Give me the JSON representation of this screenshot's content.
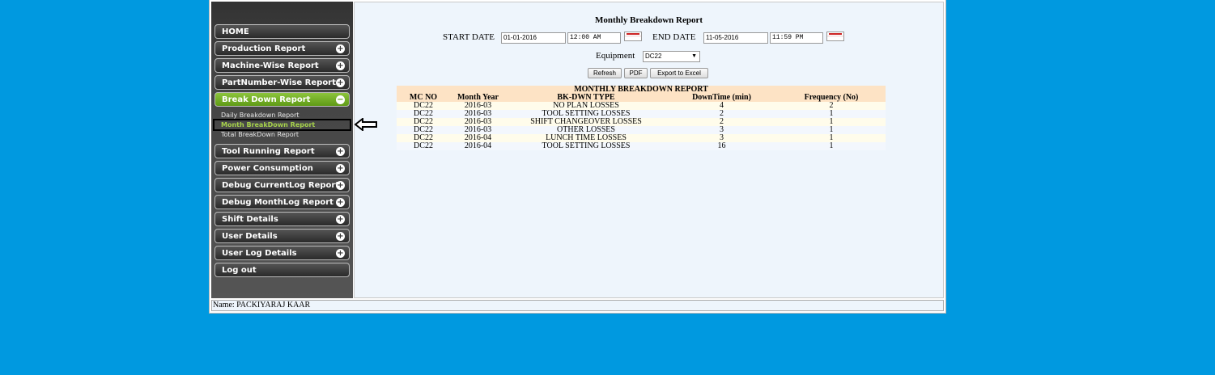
{
  "sidebar": {
    "items": [
      {
        "label": "HOME",
        "plus": false
      },
      {
        "label": "Production Report",
        "plus": true
      },
      {
        "label": "Machine-Wise Report",
        "plus": true
      },
      {
        "label": "PartNumber-Wise Report",
        "plus": true
      },
      {
        "label": "Break Down Report",
        "plus": true,
        "active": true
      },
      {
        "label": "Tool Running Report",
        "plus": true
      },
      {
        "label": "Power Consumption",
        "plus": true
      },
      {
        "label": "Debug CurrentLog Report",
        "plus": true
      },
      {
        "label": "Debug MonthLog Report",
        "plus": true
      },
      {
        "label": "Shift Details",
        "plus": true
      },
      {
        "label": "User Details",
        "plus": true
      },
      {
        "label": "User Log Details",
        "plus": true
      },
      {
        "label": "Log out",
        "plus": false
      }
    ],
    "subitems": [
      "Daily Breakdown Report",
      "Month BreakDown Report",
      "Total BreakDown Report"
    ]
  },
  "main": {
    "title": "Monthly Breakdown Report",
    "start_label": "START DATE",
    "start_date": "01-01-2016",
    "start_time": "12:00 AM",
    "end_label": "END DATE",
    "end_date": "11-05-2016",
    "end_time": "11:59 PM",
    "equipment_label": "Equipment",
    "equipment_value": "DC22",
    "buttons": {
      "refresh": "Refresh",
      "pdf": "PDF",
      "excel": "Export to Excel"
    },
    "table": {
      "caption": "MONTHLY BREAKDOWN REPORT",
      "headers": [
        "MC NO",
        "Month Year",
        "BK-DWN TYPE",
        "DownTime (min)",
        "Frequency (No)"
      ],
      "rows": [
        [
          "DC22",
          "2016-03",
          "NO PLAN LOSSES",
          "4",
          "2"
        ],
        [
          "DC22",
          "2016-03",
          "TOOL SETTING LOSSES",
          "2",
          "1"
        ],
        [
          "DC22",
          "2016-03",
          "SHIFT CHANGEOVER LOSSES",
          "2",
          "1"
        ],
        [
          "DC22",
          "2016-03",
          "OTHER LOSSES",
          "3",
          "1"
        ],
        [
          "DC22",
          "2016-04",
          "LUNCH TIME LOSSES",
          "3",
          "1"
        ],
        [
          "DC22",
          "2016-04",
          "TOOL SETTING LOSSES",
          "16",
          "1"
        ]
      ]
    }
  },
  "footer": {
    "name": "Name: PACKIYARAJ KAAR"
  },
  "colors": {
    "background": "#0099e0",
    "active_nav": "#8cc43c",
    "header_row": "#fde3c5"
  }
}
